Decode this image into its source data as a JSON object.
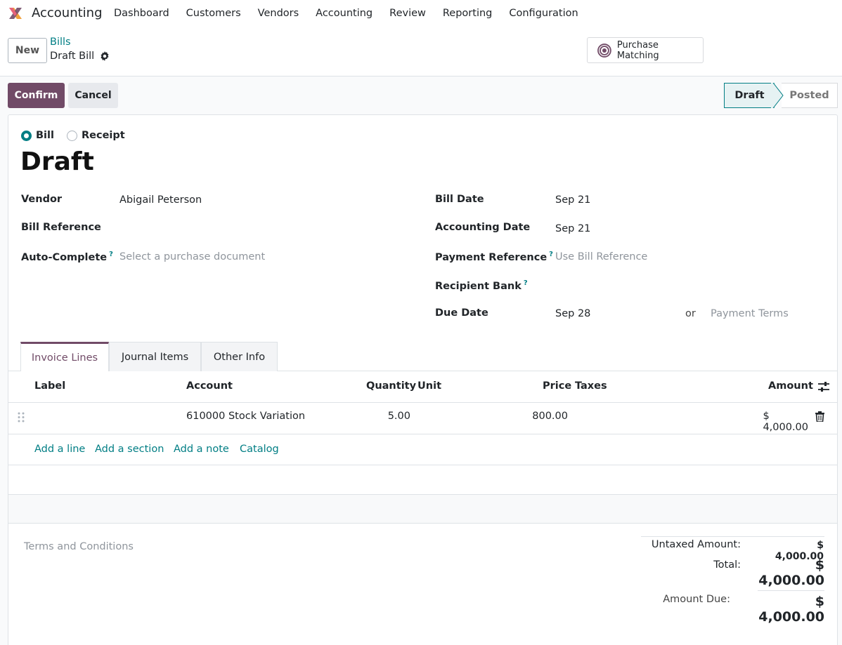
{
  "app": {
    "name": "Accounting",
    "logo_icon": "accounting-app-logo"
  },
  "nav": [
    "Dashboard",
    "Customers",
    "Vendors",
    "Accounting",
    "Review",
    "Reporting",
    "Configuration"
  ],
  "control": {
    "new_label": "New",
    "breadcrumb": "Bills",
    "record": "Draft Bill",
    "purchase_matching": "Purchase Matching"
  },
  "status": {
    "confirm": "Confirm",
    "cancel": "Cancel",
    "stages": [
      "Draft",
      "Posted"
    ],
    "active_stage": "Draft"
  },
  "form": {
    "type_options": [
      "Bill",
      "Receipt"
    ],
    "selected_type": "Bill",
    "title": "Draft",
    "vendor_label": "Vendor",
    "vendor_value": "Abigail Peterson",
    "bill_ref_label": "Bill Reference",
    "autocomplete_label": "Auto-Complete",
    "autocomplete_placeholder": "Select a purchase document",
    "bill_date_label": "Bill Date",
    "bill_date_value": "Sep 21",
    "accounting_date_label": "Accounting Date",
    "accounting_date_value": "Sep 21",
    "payment_ref_label": "Payment Reference",
    "payment_ref_placeholder": "Use Bill Reference",
    "recipient_bank_label": "Recipient Bank",
    "due_date_label": "Due Date",
    "due_date_value": "Sep 28",
    "or_text": "or",
    "payment_terms_placeholder": "Payment Terms",
    "help_mark": "?"
  },
  "tabs": [
    "Invoice Lines",
    "Journal Items",
    "Other Info"
  ],
  "table": {
    "headers": {
      "label": "Label",
      "account": "Account",
      "quantity": "Quantity",
      "unit": "Unit",
      "price": "Price",
      "taxes": "Taxes",
      "amount": "Amount"
    },
    "rows": [
      {
        "label": "",
        "account": "610000 Stock Variation",
        "quantity": "5.00",
        "unit": "",
        "price": "800.00",
        "taxes": "",
        "amount": "$ 4,000.00"
      }
    ],
    "add_links": [
      "Add a line",
      "Add a section",
      "Add a note",
      "Catalog"
    ]
  },
  "footer": {
    "terms_placeholder": "Terms and Conditions",
    "untaxed_label": "Untaxed Amount:",
    "untaxed_value": "$ 4,000.00",
    "total_label": "Total:",
    "total_value": "$ 4,000.00",
    "amount_due_label": "Amount Due:",
    "amount_due_value": "$ 4,000.00"
  },
  "colors": {
    "primary": "#714b67",
    "link": "#017e84"
  }
}
